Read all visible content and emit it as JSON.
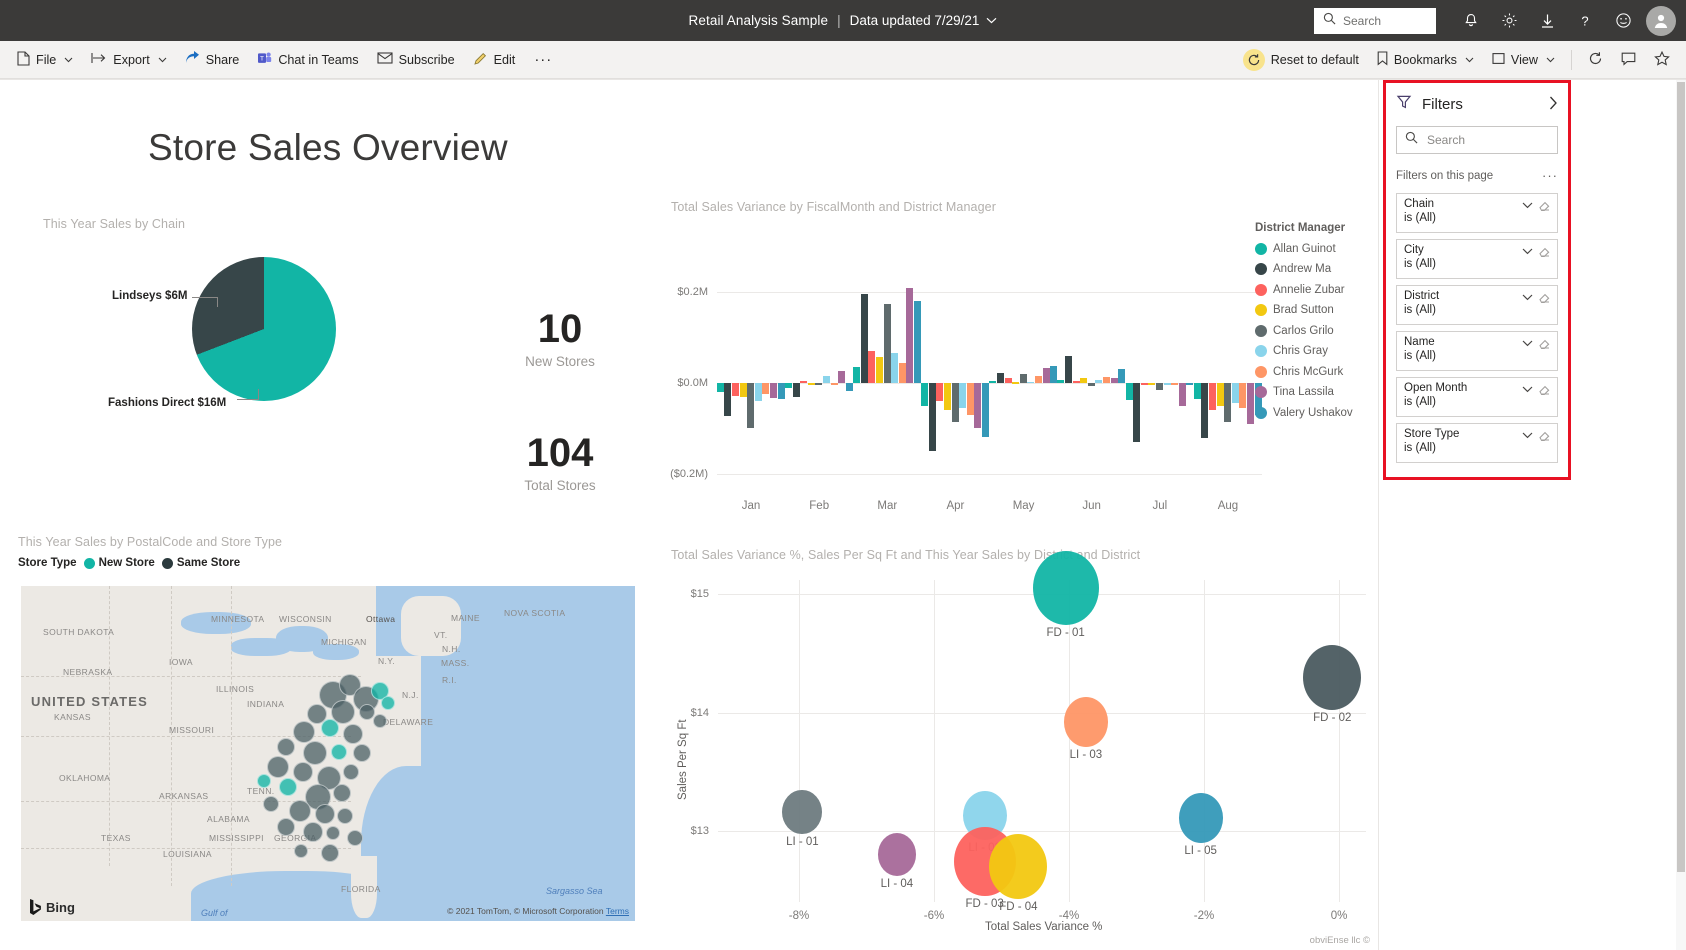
{
  "titlebar": {
    "report_name": "Retail Analysis Sample",
    "separator": "|",
    "data_updated": "Data updated 7/29/21",
    "chevron": "⌵",
    "search_placeholder": "Search",
    "icons": {
      "notifications": "notifications-bell-icon",
      "settings": "gear-icon",
      "download": "download-icon",
      "help": "help-icon",
      "feedback": "smiley-feedback-icon",
      "account": "account-avatar-icon"
    }
  },
  "commandbar": {
    "left_items": [
      {
        "label": "File",
        "icon": "file-icon",
        "has_chevron": true
      },
      {
        "label": "Export",
        "icon": "export-icon",
        "has_chevron": true
      },
      {
        "label": "Share",
        "icon": "share-icon",
        "has_chevron": false
      },
      {
        "label": "Chat in Teams",
        "icon": "teams-icon",
        "has_chevron": false
      },
      {
        "label": "Subscribe",
        "icon": "envelope-icon",
        "has_chevron": false
      },
      {
        "label": "Edit",
        "icon": "pencil-icon",
        "has_chevron": false
      }
    ],
    "more_label": "···",
    "right_items": [
      {
        "label": "Reset to default",
        "icon": "reset-icon",
        "has_chevron": false
      },
      {
        "label": "Bookmarks",
        "icon": "bookmark-icon",
        "has_chevron": true
      },
      {
        "label": "View",
        "icon": "view-icon",
        "has_chevron": true
      }
    ],
    "right_icons": [
      {
        "name": "refresh-icon",
        "glyph": "⟳"
      },
      {
        "name": "comment-icon",
        "glyph": "⬚"
      },
      {
        "name": "favorite-star-icon",
        "glyph": "☆"
      }
    ]
  },
  "report": {
    "page_title": "Store Sales Overview"
  },
  "pie": {
    "title": "This Year Sales by Chain",
    "labels": {
      "lindseys": "Lindseys $6M",
      "fashions_direct": "Fashions Direct $16M"
    }
  },
  "kpis": [
    {
      "value": "10",
      "caption": "New Stores"
    },
    {
      "value": "104",
      "caption": "Total Stores"
    }
  ],
  "map": {
    "title": "This Year Sales by PostalCode and Store Type",
    "legend_title": "Store Type",
    "legend": [
      {
        "label": "New Store",
        "color": "#12b5a5"
      },
      {
        "label": "Same Store",
        "color": "#374649"
      }
    ],
    "provider": "Bing",
    "attribution": "© 2021 TomTom, © Microsoft Corporation",
    "attribution_link": "Terms",
    "sea_label": "Sargasso Sea",
    "gulf_label": "Gulf of",
    "country_label": "UNITED STATES",
    "state_labels": [
      "MINNESOTA",
      "WISCONSIN",
      "MICHIGAN",
      "Ottawa",
      "MAINE",
      "NOVA SCOTIA",
      "SOUTH DAKOTA",
      "IOWA",
      "N.Y.",
      "VT.",
      "N.H.",
      "MASS.",
      "R.I.",
      "NEBRASKA",
      "ILLINOIS",
      "INDIANA",
      "N.J.",
      "DELAWARE",
      "KANSAS",
      "MISSOURI",
      "OKLAHOMA",
      "TENN.",
      "ARKANSAS",
      "TEXAS",
      "MISSISSIPPI",
      "ALABAMA",
      "GEORGIA",
      "LOUISIANA",
      "FLORIDA"
    ]
  },
  "chart_data": [
    {
      "id": "bar-chart",
      "type": "bar",
      "title": "Total Sales Variance by FiscalMonth and District Manager",
      "xlabel": "",
      "ylabel": "",
      "categories": [
        "Jan",
        "Feb",
        "Mar",
        "Apr",
        "May",
        "Jun",
        "Jul",
        "Aug"
      ],
      "yticks": [
        "$0.2M",
        "$0.0M",
        "($0.2M)"
      ],
      "ylim": [
        -0.2,
        0.2
      ],
      "legend_title": "District Manager",
      "legend_position": "right",
      "grid": true,
      "series": [
        {
          "name": "Allan Guinot",
          "color": "#12b5a5",
          "values": [
            -0.02,
            -0.01,
            0.036,
            -0.05,
            0.004,
            0.007,
            -0.038,
            -0.035
          ]
        },
        {
          "name": "Andrew Ma",
          "color": "#374649",
          "values": [
            -0.072,
            -0.03,
            0.197,
            -0.15,
            0.022,
            0.06,
            -0.13,
            -0.12
          ]
        },
        {
          "name": "Annelie Zubar",
          "color": "#fd625e",
          "values": [
            -0.028,
            0.005,
            0.07,
            -0.04,
            0.012,
            0.004,
            -0.005,
            -0.06
          ]
        },
        {
          "name": "Brad Sutton",
          "color": "#f2c811",
          "values": [
            -0.03,
            -0.004,
            0.058,
            -0.06,
            0.002,
            0.012,
            -0.002,
            -0.05
          ]
        },
        {
          "name": "Carlos Grilo",
          "color": "#5f6b6d",
          "values": [
            -0.1,
            -0.002,
            0.175,
            -0.085,
            0.02,
            -0.006,
            -0.015,
            -0.085
          ]
        },
        {
          "name": "Chris Gray",
          "color": "#8ad4eb",
          "values": [
            -0.04,
            0.015,
            0.065,
            -0.055,
            0.003,
            0.007,
            -0.004,
            -0.045
          ]
        },
        {
          "name": "Chris McGurk",
          "color": "#fe9666",
          "values": [
            -0.025,
            -0.002,
            0.045,
            -0.07,
            0.015,
            0.014,
            -0.003,
            -0.055
          ]
        },
        {
          "name": "Tina Lassila",
          "color": "#a66999",
          "values": [
            -0.032,
            0.026,
            0.21,
            -0.1,
            0.032,
            0.01,
            -0.05,
            -0.09
          ]
        },
        {
          "name": "Valery Ushakov",
          "color": "#3599b8",
          "values": [
            -0.035,
            -0.018,
            0.18,
            -0.118,
            0.038,
            0.03,
            -0.002,
            -0.07
          ]
        }
      ]
    },
    {
      "id": "bubble-chart",
      "type": "scatter",
      "title": "Total Sales Variance %, Sales Per Sq Ft and This Year Sales by District and District",
      "xlabel": "Total Sales Variance %",
      "ylabel": "Sales Per Sq Ft",
      "xticks": [
        "-8%",
        "-6%",
        "-4%",
        "-2%",
        "0%"
      ],
      "yticks": [
        "$15",
        "$14",
        "$13"
      ],
      "xlim": [
        -0.09,
        0.005
      ],
      "ylim": [
        12.4,
        15.1
      ],
      "grid": true,
      "points": [
        {
          "label": "FD - 01",
          "x": -0.0405,
          "y": 15.05,
          "size": 66,
          "color": "#12b5a5"
        },
        {
          "label": "FD - 02",
          "x": -0.001,
          "y": 14.3,
          "size": 58,
          "color": "#4b5b60"
        },
        {
          "label": "LI - 03",
          "x": -0.0375,
          "y": 13.92,
          "size": 44,
          "color": "#fe9666"
        },
        {
          "label": "LI - 01",
          "x": -0.0795,
          "y": 13.16,
          "size": 40,
          "color": "#6e7b7f"
        },
        {
          "label": "LI - 02",
          "x": -0.0525,
          "y": 13.13,
          "size": 44,
          "color": "#8ad4eb"
        },
        {
          "label": "LI - 05",
          "x": -0.0205,
          "y": 13.11,
          "size": 44,
          "color": "#3599b8"
        },
        {
          "label": "LI - 04",
          "x": -0.0655,
          "y": 12.8,
          "size": 38,
          "color": "#a66999"
        },
        {
          "label": "FD - 03",
          "x": -0.0525,
          "y": 12.74,
          "size": 62,
          "color": "#fd625e"
        },
        {
          "label": "FD - 04",
          "x": -0.0475,
          "y": 12.7,
          "size": 58,
          "color": "#f2c811"
        }
      ]
    }
  ],
  "filters": {
    "title": "Filters",
    "expand_glyph": "›",
    "search_placeholder": "Search",
    "section_label": "Filters on this page",
    "more_glyph": "···",
    "items": [
      {
        "name": "Chain",
        "value": "is (All)"
      },
      {
        "name": "City",
        "value": "is (All)"
      },
      {
        "name": "District",
        "value": "is (All)"
      },
      {
        "name": "Name",
        "value": "is (All)"
      },
      {
        "name": "Open Month",
        "value": "is (All)"
      },
      {
        "name": "Store Type",
        "value": "is (All)"
      }
    ],
    "highlight_color": "#e81123"
  },
  "footer": {
    "watermark": "obviEnse llc ©"
  },
  "colors": {
    "teal": "#12b5a5",
    "dark": "#374649",
    "header_bg": "#3b3a39",
    "cmdbar_bg": "#f3f2f1"
  }
}
